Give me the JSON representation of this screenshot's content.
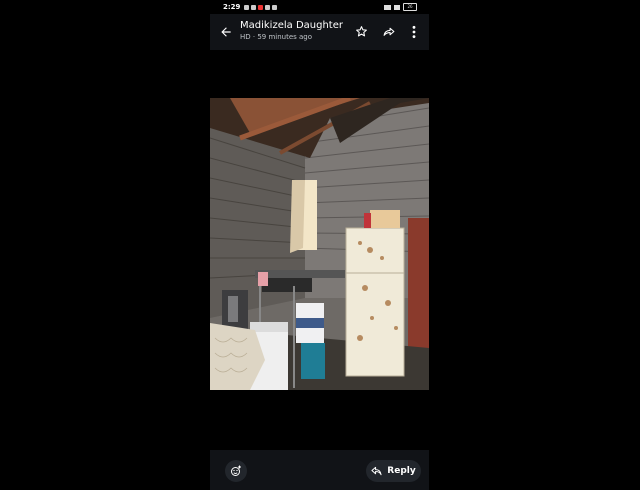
{
  "status_bar": {
    "time": "2:29",
    "battery": "26"
  },
  "header": {
    "title": "Madikizela Daughter",
    "subtitle": "HD · 59 minutes ago"
  },
  "icons": {
    "back": "back-arrow-icon",
    "star": "star-icon",
    "forward": "forward-icon",
    "more": "more-vertical-icon",
    "emoji": "add-reaction-icon",
    "reply": "reply-icon"
  },
  "footer": {
    "reply_label": "Reply"
  }
}
